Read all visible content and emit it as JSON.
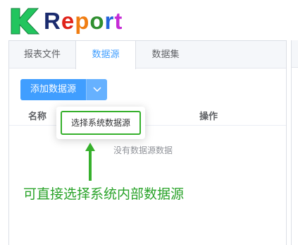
{
  "logo": {
    "letters": [
      {
        "ch": "R",
        "color": "#1a2b6e"
      },
      {
        "ch": "e",
        "color": "#e0231a"
      },
      {
        "ch": "p",
        "color": "#f07d12"
      },
      {
        "ch": "o",
        "color": "#2f8f2f"
      },
      {
        "ch": "r",
        "color": "#2563d9"
      },
      {
        "ch": "t",
        "color": "#c52ad6"
      }
    ],
    "k_color": "#22c55e"
  },
  "tabs": [
    {
      "label": "报表文件",
      "active": false
    },
    {
      "label": "数据源",
      "active": true
    },
    {
      "label": "数据集",
      "active": false
    }
  ],
  "toolbar": {
    "add_label": "添加数据源"
  },
  "table": {
    "col_name": "名称",
    "col_action": "操作",
    "empty_text": "没有数据源数据"
  },
  "dropdown": {
    "item_label": "选择系统数据源"
  },
  "annotation": {
    "text": "可直接选择系统内部数据源",
    "color": "#29a329"
  },
  "colors": {
    "primary": "#409eff",
    "highlight": "#36b02c"
  }
}
